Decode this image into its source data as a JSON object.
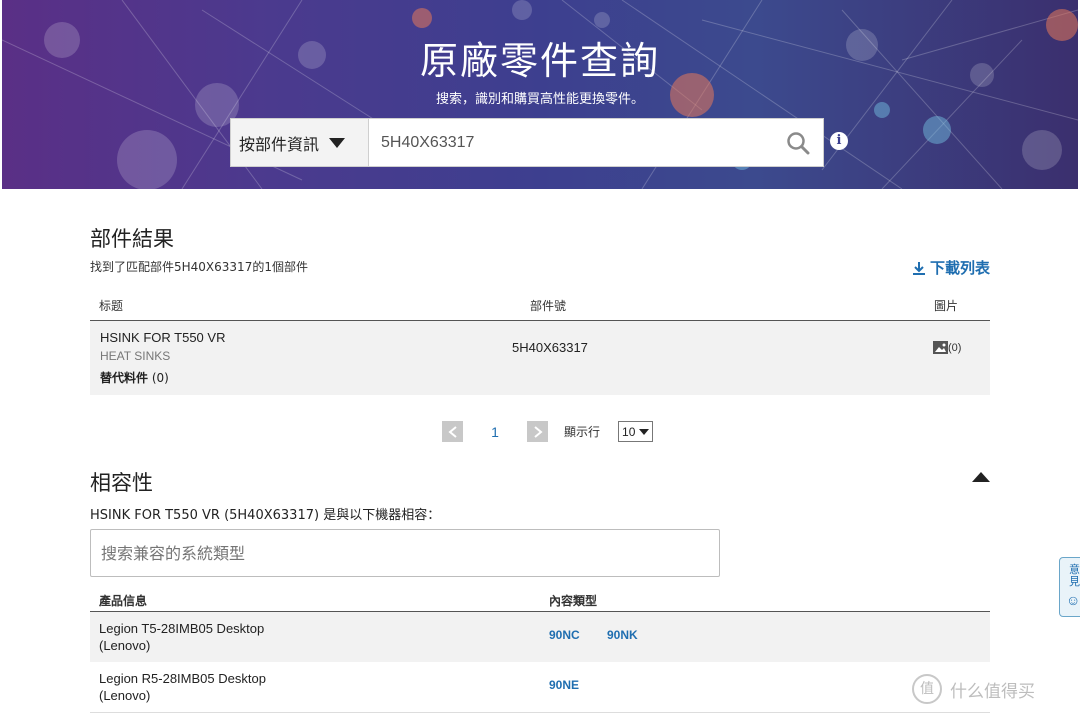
{
  "hero": {
    "title": "原廠零件查詢",
    "subtitle": "搜索，識別和購買高性能更換零件。",
    "search_type": "按部件資訊",
    "search_value": "5H40X63317",
    "search_icon": "search-icon",
    "info_icon": "info-icon",
    "info_glyph": "i"
  },
  "parts": {
    "heading": "部件結果",
    "found_text": "找到了匹配部件5H40X63317的1個部件",
    "download_label": "下載列表",
    "columns": [
      "标题",
      "部件號",
      "圖片"
    ],
    "rows": [
      {
        "name": "HSINK FOR T550 VR",
        "category": "HEAT SINKS",
        "alt_label": "替代料件",
        "alt_count": "(0)",
        "part_number": "5H40X63317",
        "image_count": "(0)"
      }
    ]
  },
  "pagination": {
    "current_page": "1",
    "per_page_label": "顯示行",
    "per_page_value": "10"
  },
  "compatibility": {
    "heading": "相容性",
    "description": "HSINK FOR T550 VR (5H40X63317) 是與以下機器相容：",
    "search_placeholder": "搜索兼容的系統類型",
    "columns": [
      "產品信息",
      "內容類型"
    ],
    "rows": [
      {
        "name": "Legion T5-28IMB05 Desktop",
        "brand": "(Lenovo)",
        "types": [
          "90NC",
          "90NK"
        ]
      },
      {
        "name": "Legion R5-28IMB05 Desktop",
        "brand": "(Lenovo)",
        "types": [
          "90NE"
        ]
      }
    ]
  },
  "feedback": {
    "label": "意見",
    "smile_glyph": "☺"
  },
  "watermark": {
    "logo_glyph": "值",
    "text": "什么值得买"
  },
  "colors": {
    "link": "#1f6eb0",
    "hero_purple": "#5a2f86",
    "row_shade": "#f2f2f2"
  }
}
